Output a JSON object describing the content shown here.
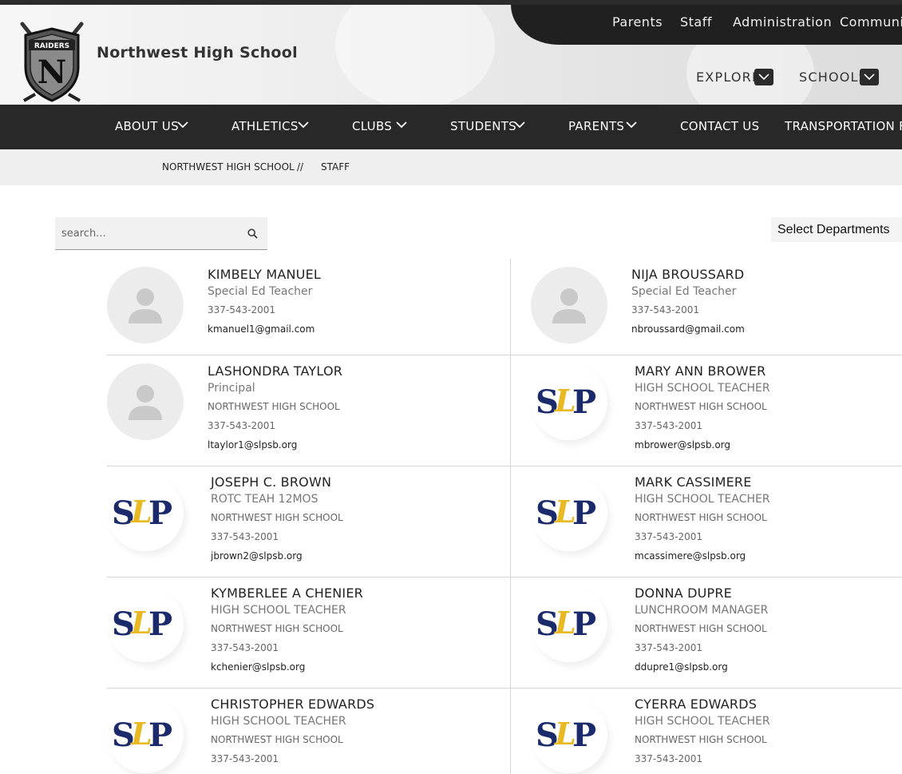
{
  "header": {
    "school_name": "Northwest High School",
    "logo_text": "RAIDERS",
    "logo_letter": "N",
    "top_links": [
      "Parents",
      "Staff",
      "Administration",
      "Community"
    ],
    "explore_label": "EXPLORE",
    "schools_label": "SCHOOLS"
  },
  "nav": {
    "items": [
      "ABOUT US",
      "ATHLETICS",
      "CLUBS",
      "STUDENTS",
      "PARENTS",
      "CONTACT US",
      "TRANSPORTATION FOR"
    ]
  },
  "breadcrumb": {
    "home": "NORTHWEST HIGH SCHOOL",
    "separator": "//",
    "current": "STAFF"
  },
  "search": {
    "placeholder": "search..."
  },
  "department_select": {
    "selected": "Select Departments"
  },
  "staff": [
    {
      "name": "KIMBELY MANUEL",
      "title": "Special Ed Teacher",
      "school": "",
      "phone": "337-543-2001",
      "email": "kmanuel1@gmail.com",
      "avatar": "placeholder-person-icon"
    },
    {
      "name": "NIJA BROUSSARD",
      "title": "Special Ed Teacher",
      "school": "",
      "phone": "337-543-2001",
      "email": "nbroussard@gmail.com",
      "avatar": "placeholder-person-icon"
    },
    {
      "name": "LASHONDRA TAYLOR",
      "title": "Principal",
      "school": "NORTHWEST HIGH SCHOOL",
      "phone": "337-543-2001",
      "email": "ltaylor1@slpsb.org",
      "avatar": "placeholder-person-icon"
    },
    {
      "name": "MARY ANN BROWER",
      "title": "HIGH SCHOOL TEACHER",
      "school": "NORTHWEST HIGH SCHOOL",
      "phone": "337-543-2001",
      "email": "mbrower@slpsb.org",
      "avatar": "slp-logo"
    },
    {
      "name": "JOSEPH C. BROWN",
      "title": "ROTC TEAH 12MOS",
      "school": "NORTHWEST HIGH SCHOOL",
      "phone": "337-543-2001",
      "email": "jbrown2@slpsb.org",
      "avatar": "slp-logo"
    },
    {
      "name": "MARK CASSIMERE",
      "title": "HIGH SCHOOL TEACHER",
      "school": "NORTHWEST HIGH SCHOOL",
      "phone": "337-543-2001",
      "email": "mcassimere@slpsb.org",
      "avatar": "slp-logo"
    },
    {
      "name": "KYMBERLEE A CHENIER",
      "title": "HIGH SCHOOL TEACHER",
      "school": "NORTHWEST HIGH SCHOOL",
      "phone": "337-543-2001",
      "email": "kchenier@slpsb.org",
      "avatar": "slp-logo"
    },
    {
      "name": "DONNA DUPRE",
      "title": "LUNCHROOM MANAGER",
      "school": "NORTHWEST HIGH SCHOOL",
      "phone": "337-543-2001",
      "email": "ddupre1@slpsb.org",
      "avatar": "slp-logo"
    },
    {
      "name": "CHRISTOPHER EDWARDS",
      "title": "HIGH SCHOOL TEACHER",
      "school": "NORTHWEST HIGH SCHOOL",
      "phone": "337-543-2001",
      "email": "",
      "avatar": "slp-logo"
    },
    {
      "name": "CYERRA EDWARDS",
      "title": "HIGH SCHOOL TEACHER",
      "school": "NORTHWEST HIGH SCHOOL",
      "phone": "337-543-2001",
      "email": "",
      "avatar": "slp-logo"
    }
  ],
  "colors": {
    "nav_bg": "#282828",
    "slp_navy": "#1b2a6b",
    "slp_gold": "#e8b923"
  }
}
